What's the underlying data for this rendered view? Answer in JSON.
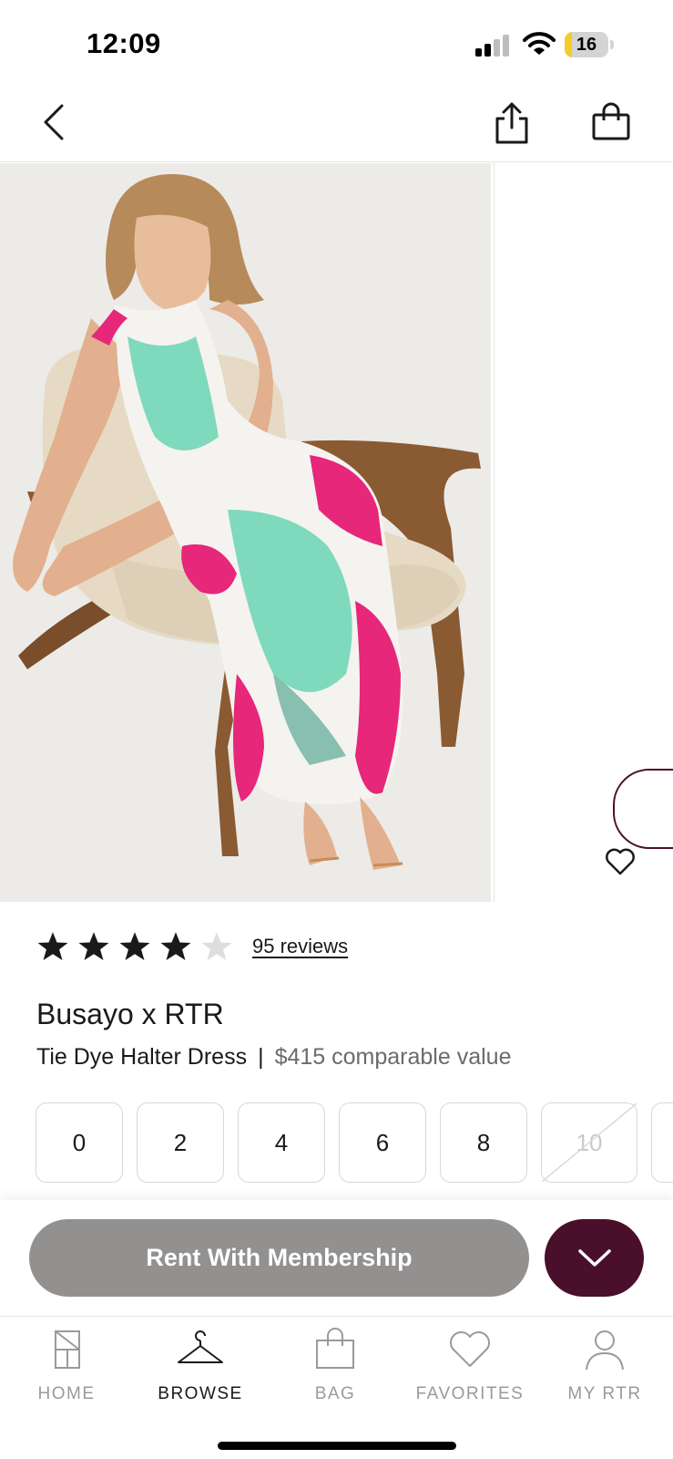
{
  "status_bar": {
    "time": "12:09",
    "battery_level": "16",
    "battery_fraction": 0.16
  },
  "header": {
    "back_icon": "chevron-left-icon",
    "share_icon": "share-icon",
    "bag_icon": "shopping-bag-icon"
  },
  "product": {
    "rating": 4,
    "rating_max": 5,
    "reviews_label": "95 reviews",
    "brand": "Busayo x RTR",
    "name": "Tie Dye Halter Dress",
    "separator": "|",
    "price_label": "$415 comparable value"
  },
  "sizes": [
    {
      "label": "0",
      "available": true
    },
    {
      "label": "2",
      "available": true
    },
    {
      "label": "4",
      "available": true
    },
    {
      "label": "6",
      "available": true
    },
    {
      "label": "8",
      "available": true
    },
    {
      "label": "10",
      "available": false
    },
    {
      "label": "",
      "available": true
    }
  ],
  "cta": {
    "rent_label": "Rent With Membership",
    "expand_icon": "chevron-down-icon"
  },
  "tabs": [
    {
      "label": "HOME",
      "icon": "home-icon",
      "active": false
    },
    {
      "label": "BROWSE",
      "icon": "hanger-icon",
      "active": true
    },
    {
      "label": "BAG",
      "icon": "bag-icon",
      "active": false
    },
    {
      "label": "FAVORITES",
      "icon": "heart-icon",
      "active": false
    },
    {
      "label": "MY RTR",
      "icon": "person-icon",
      "active": false
    }
  ],
  "colors": {
    "accent": "#4a0f2a",
    "cta_gray": "#939090",
    "dress_pink": "#e6277a",
    "dress_mint": "#7fd9bd"
  }
}
